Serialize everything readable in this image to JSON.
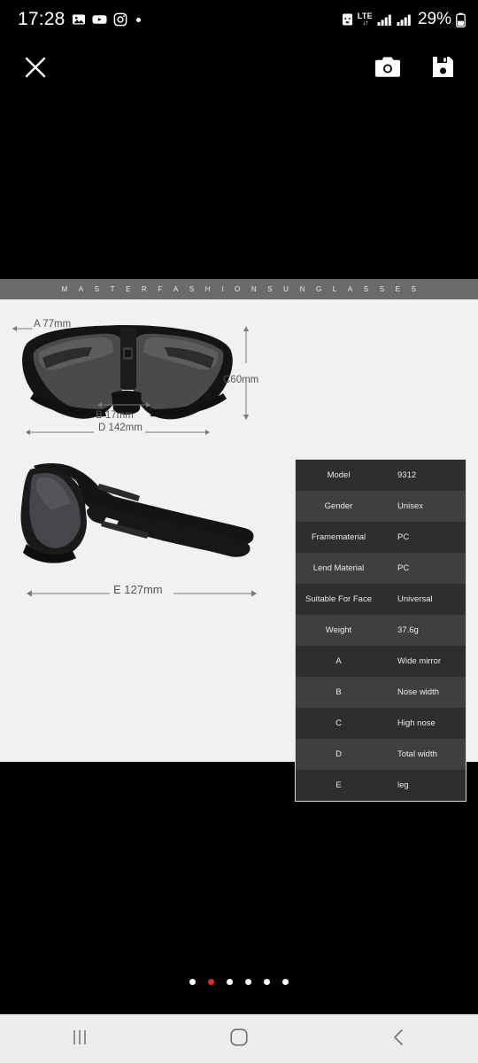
{
  "status_bar": {
    "time": "17:28",
    "left_icons": [
      "gallery-icon",
      "youtube-icon",
      "instagram-icon",
      "dot-icon"
    ],
    "battery_saver_icon": "battery-saver-icon",
    "network_type": "LTE",
    "data_arrows": "↓↑",
    "signal_icons": [
      "signal-bars-sim1-icon",
      "signal-bars-sim2-icon"
    ],
    "battery_percent": "29%"
  },
  "app_bar": {
    "close_icon": "close-icon",
    "camera_label": "camera-icon",
    "save_label": "save-icon"
  },
  "product_image": {
    "brand_banner": "MASTERFASHIONSUNGLASSES",
    "dimensions": {
      "a": "A 77mm",
      "b": "B 17mm",
      "c": "C60mm",
      "d": "D 142mm",
      "e": "E 127mm"
    },
    "spec_table": {
      "rows": [
        {
          "key": "Model",
          "value": "9312"
        },
        {
          "key": "Gender",
          "value": "Unisex"
        },
        {
          "key": "Framematerial",
          "value": "PC"
        },
        {
          "key": "Lend Material",
          "value": "PC"
        },
        {
          "key": "Suitable For Face",
          "value": "Universal"
        },
        {
          "key": "Weight",
          "value": "37.6g"
        },
        {
          "key": "A",
          "value": "Wide mirror"
        },
        {
          "key": "B",
          "value": "Nose width"
        },
        {
          "key": "C",
          "value": "High nose"
        },
        {
          "key": "D",
          "value": "Total width"
        },
        {
          "key": "E",
          "value": "leg"
        }
      ]
    }
  },
  "pagination": {
    "count": 6,
    "active_index": 1,
    "active_color": "#e02b20",
    "inactive_color": "#ffffff"
  },
  "nav_bar": {
    "recents_label": "recents-icon",
    "home_label": "home-icon",
    "back_label": "back-icon"
  }
}
